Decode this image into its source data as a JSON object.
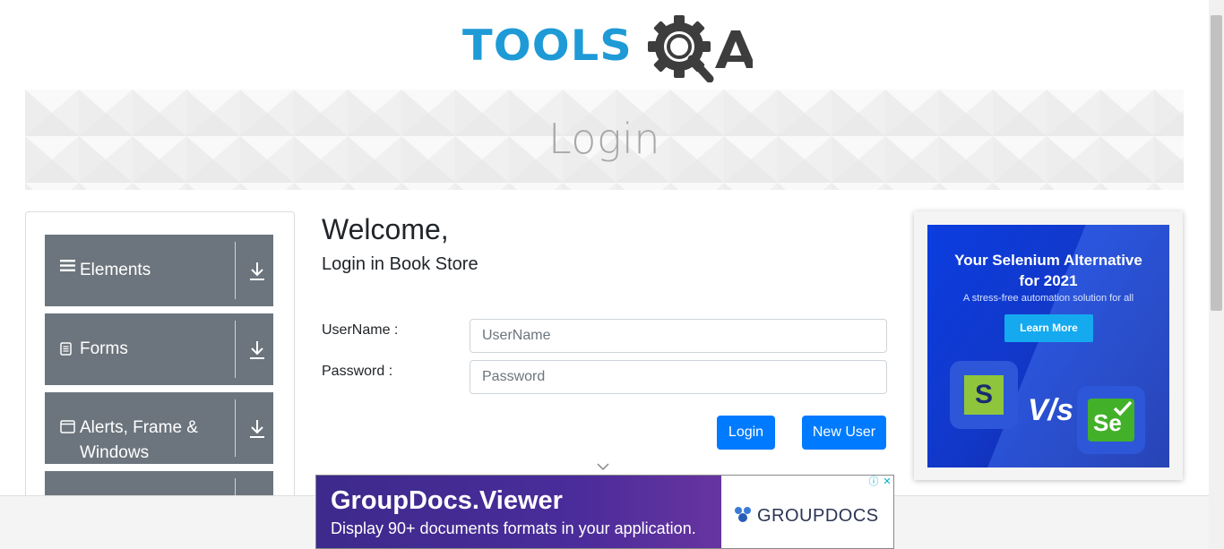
{
  "header": {
    "logo_text": "TOOLSQA"
  },
  "banner": {
    "title": "Login"
  },
  "sidebar": {
    "groups": [
      {
        "label": "Elements",
        "icon": "hamburger-icon"
      },
      {
        "label": "Forms",
        "icon": "document-icon"
      },
      {
        "label": "Alerts, Frame &",
        "label2": "Windows",
        "icon": "window-icon"
      },
      {
        "label": "",
        "icon": ""
      }
    ]
  },
  "form": {
    "heading": "Welcome,",
    "subheading": "Login in Book Store",
    "username_label": "UserName :",
    "username_placeholder": "UserName",
    "username_value": "",
    "password_label": "Password :",
    "password_placeholder": "Password",
    "password_value": "",
    "login_button": "Login",
    "new_user_button": "New User"
  },
  "side_ad": {
    "title_line1": "Your Selenium Alternative",
    "title_line2": "for 2021",
    "subtitle": "A stress-free automation solution for all",
    "cta": "Learn More",
    "vs_text": "V/s",
    "se_text": "Se",
    "s_text": "S"
  },
  "bottom_ad": {
    "title": "GroupDocs.Viewer",
    "subtitle": "Display 90+ documents formats in your application.",
    "brand": "GROUPDOCS",
    "info_icon": "ⓘ",
    "close_icon": "✕"
  },
  "colors": {
    "accent_blue": "#007bff",
    "logo_blue": "#1e9ad6",
    "sidebar_gray": "#6c757d"
  }
}
